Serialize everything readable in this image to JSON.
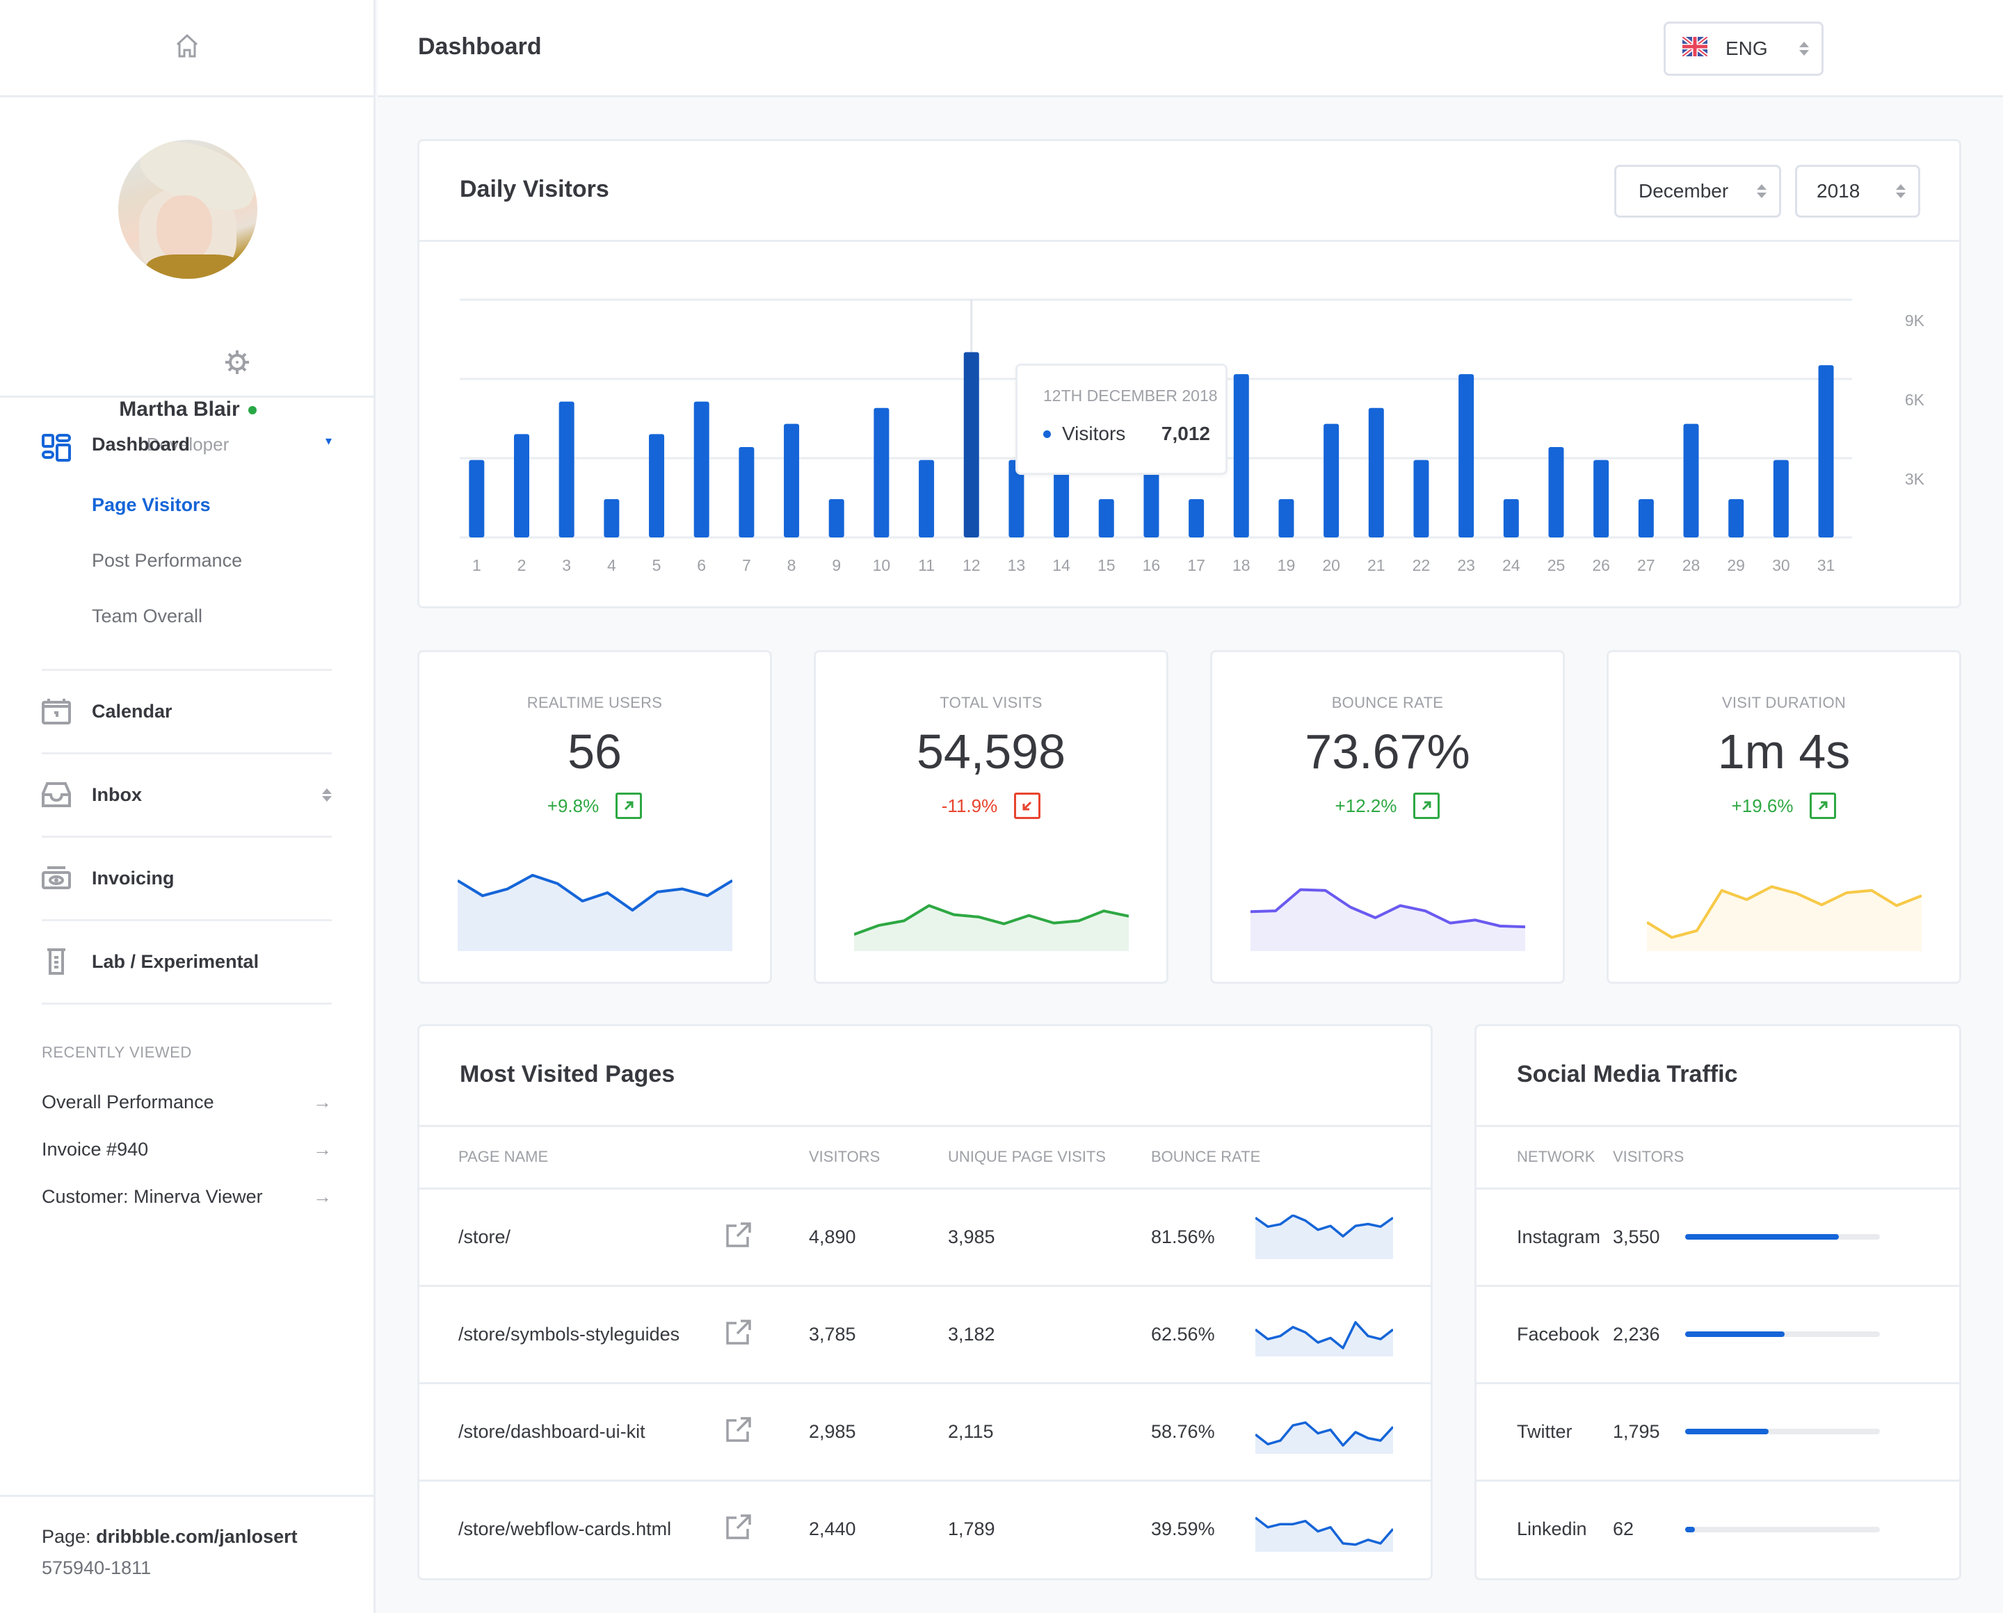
{
  "sidebar": {
    "home_icon": "home-icon",
    "profile": {
      "name": "Martha Blair",
      "role": "Developer",
      "status": "online",
      "status_color": "#28a745"
    },
    "nav": [
      {
        "label": "Dashboard",
        "icon": "dashboard-icon",
        "expanded": true,
        "sub": [
          "Page Visitors",
          "Post Performance",
          "Team Overall"
        ],
        "active_sub": "Page Visitors"
      },
      {
        "label": "Calendar",
        "icon": "calendar-icon"
      },
      {
        "label": "Inbox",
        "icon": "inbox-icon"
      },
      {
        "label": "Invoicing",
        "icon": "invoicing-icon"
      },
      {
        "label": "Lab / Experimental",
        "icon": "lab-icon"
      }
    ],
    "recent_title": "RECENTLY VIEWED",
    "recent": [
      "Overall Performance",
      "Invoice #940",
      "Customer: Minerva Viewer"
    ],
    "arrow": "→",
    "footer": {
      "page_label": "Page:",
      "page_value": "dribbble.com/janlosert",
      "phone": "575940-1811"
    }
  },
  "header": {
    "title": "Dashboard",
    "language": "ENG"
  },
  "daily_visitors": {
    "title": "Daily Visitors",
    "month": "December",
    "year": "2018",
    "tooltip": {
      "date": "12TH DECEMBER 2018",
      "label": "Visitors",
      "value": "7,012"
    }
  },
  "chart_data": {
    "type": "bar",
    "title": "Daily Visitors",
    "xlabel": "",
    "ylabel": "",
    "categories": [
      "1",
      "2",
      "3",
      "4",
      "5",
      "6",
      "7",
      "8",
      "9",
      "10",
      "11",
      "12",
      "13",
      "14",
      "15",
      "16",
      "17",
      "18",
      "19",
      "20",
      "21",
      "22",
      "23",
      "24",
      "25",
      "26",
      "27",
      "28",
      "29",
      "30",
      "31"
    ],
    "values": [
      2930,
      3910,
      5140,
      1450,
      3910,
      5140,
      3420,
      4300,
      1450,
      4900,
      2930,
      7012,
      2930,
      2930,
      1450,
      2930,
      1450,
      6180,
      1450,
      4300,
      4900,
      2930,
      6180,
      1450,
      3420,
      2930,
      1450,
      4300,
      1450,
      2930,
      6520
    ],
    "highlighted_index": 11,
    "yticks": [
      "3K",
      "6K",
      "9K"
    ],
    "ylim": [
      0,
      9000
    ],
    "grid": true,
    "y_axis_side": "right",
    "color": "#1565d8",
    "highlight_color": "#1350ae"
  },
  "stats": [
    {
      "label": "REALTIME USERS",
      "value": "56",
      "change": "+9.8%",
      "trend": "up",
      "color": "#1565d8",
      "fill": "#e6eefa",
      "spark": [
        93,
        73,
        82,
        100,
        89,
        66,
        77,
        54,
        78,
        82,
        73,
        93
      ]
    },
    {
      "label": "TOTAL VISITS",
      "value": "54,598",
      "change": "-11.9%",
      "trend": "down",
      "color": "#2ea843",
      "fill": "#e9f5eb",
      "spark": [
        22,
        34,
        40,
        60,
        48,
        45,
        36,
        47,
        37,
        40,
        53,
        46
      ]
    },
    {
      "label": "BOUNCE RATE",
      "value": "73.67%",
      "change": "+12.2%",
      "trend": "up",
      "color": "#6a5af0",
      "fill": "#eeedfc",
      "spark": [
        52,
        53,
        81,
        80,
        58,
        44,
        60,
        53,
        37,
        41,
        33,
        32
      ]
    },
    {
      "label": "VISIT DURATION",
      "value": "1m 4s",
      "change": "+19.6%",
      "trend": "up",
      "color": "#f7c948",
      "fill": "#fef9eb",
      "spark": [
        38,
        18,
        27,
        80,
        68,
        85,
        76,
        61,
        77,
        80,
        60,
        73
      ]
    }
  ],
  "trend_colors": {
    "up": "#2ea843",
    "down": "#e8442e"
  },
  "most_visited": {
    "title": "Most Visited Pages",
    "columns": [
      "PAGE NAME",
      "VISITORS",
      "UNIQUE PAGE VISITS",
      "BOUNCE RATE"
    ],
    "rows": [
      {
        "page": "/store/",
        "visitors": "4,890",
        "unique": "3,985",
        "bounce": "81.56%",
        "spark": [
          172,
          135,
          145,
          182,
          160,
          122,
          138,
          95,
          138,
          146,
          135,
          172
        ]
      },
      {
        "page": "/store/symbols-styleguides",
        "visitors": "3,785",
        "unique": "3,182",
        "bounce": "62.56%",
        "spark": [
          112,
          72,
          85,
          122,
          100,
          58,
          77,
          35,
          142,
          85,
          72,
          112
        ]
      },
      {
        "page": "/store/dashboard-ui-kit",
        "visitors": "2,985",
        "unique": "2,115",
        "bounce": "58.76%",
        "spark": [
          80,
          40,
          55,
          118,
          130,
          85,
          100,
          35,
          90,
          65,
          55,
          112
        ]
      },
      {
        "page": "/store/webflow-cards.html",
        "visitors": "2,440",
        "unique": "1,789",
        "bounce": "39.59%",
        "spark": [
          142,
          102,
          115,
          115,
          128,
          85,
          102,
          35,
          30,
          50,
          35,
          95
        ]
      }
    ]
  },
  "social": {
    "title": "Social Media Traffic",
    "columns": [
      "NETWORK",
      "VISITORS"
    ],
    "rows": [
      {
        "network": "Instagram",
        "visitors": "3,550",
        "progress": 0.79
      },
      {
        "network": "Facebook",
        "visitors": "2,236",
        "progress": 0.51
      },
      {
        "network": "Twitter",
        "visitors": "1,795",
        "progress": 0.43
      },
      {
        "network": "Linkedin",
        "visitors": "62",
        "progress": 0.05
      }
    ]
  }
}
